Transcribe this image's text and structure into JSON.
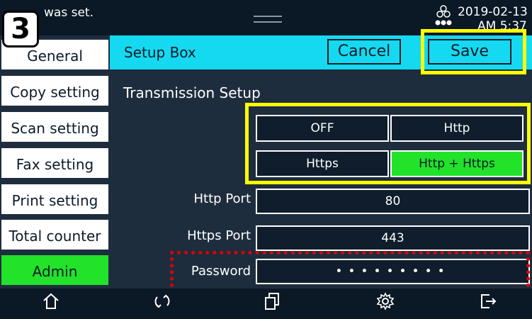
{
  "status": {
    "message": "was set.",
    "date": "2019-02-13",
    "time": "AM 5:37"
  },
  "step_number": "3",
  "sidebar": {
    "items": [
      {
        "label": "General"
      },
      {
        "label": "Copy setting"
      },
      {
        "label": "Scan setting"
      },
      {
        "label": "Fax setting"
      },
      {
        "label": "Print setting"
      },
      {
        "label": "Total counter"
      },
      {
        "label": "Admin",
        "active": true
      }
    ]
  },
  "header": {
    "title": "Setup Box",
    "cancel_label": "Cancel",
    "save_label": "Save"
  },
  "section": {
    "title": "Transmission Setup"
  },
  "options": [
    {
      "label": "OFF"
    },
    {
      "label": "Http"
    },
    {
      "label": "Https"
    },
    {
      "label": "Http + Https",
      "selected": true
    }
  ],
  "fields": {
    "http_port": {
      "label": "Http Port",
      "value": "80"
    },
    "https_port": {
      "label": "Https Port",
      "value": "443"
    },
    "password": {
      "label": "Password",
      "value": "•••••••••"
    }
  },
  "bottom_nav": [
    "home-icon",
    "refresh-icon",
    "copy-icon",
    "settings-icon",
    "logout-icon"
  ],
  "colors": {
    "accent": "#15d9f0",
    "selected": "#22e22a",
    "highlight": "#ffff00",
    "password_highlight": "#e00000"
  }
}
